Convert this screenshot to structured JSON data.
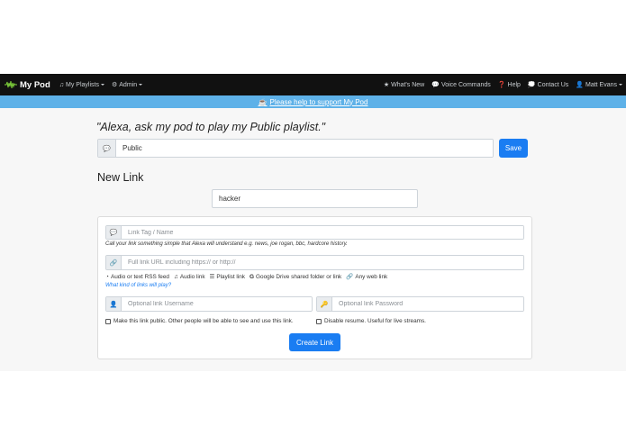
{
  "navbar": {
    "brand": "My Pod",
    "playlists": "My Playlists",
    "admin": "Admin",
    "whats_new": "What's New",
    "voice_commands": "Voice Commands",
    "help": "Help",
    "contact": "Contact Us",
    "user": "Matt Evans"
  },
  "banner": {
    "text": "Please help to support My Pod"
  },
  "quote": "\"Alexa, ask my pod to play my Public playlist.\"",
  "playlist": {
    "name_value": "Public",
    "save_label": "Save"
  },
  "new_link": {
    "heading": "New Link",
    "search_value": "hacker",
    "tag_placeholder": "Link Tag / Name",
    "tag_help": "Call your link something simple that Alexa will understand e.g. news, joe rogan, bbc, hardcore history.",
    "url_placeholder": "Full link URL including https:// or http://",
    "types": {
      "audio_feed": "Audio or text RSS feed",
      "audio_link": "Audio link",
      "playlist_link": "Playlist link",
      "gdrive": "Google Drive shared folder or link",
      "web": "Any web link"
    },
    "types_link": "What kind of links will play?",
    "username_placeholder": "Optional link Username",
    "password_placeholder": "Optional link Password",
    "public_label": "Make this link public. Other people will be able to see and use this link.",
    "resume_label": "Disable resume. Useful for live streams.",
    "create_label": "Create Link"
  },
  "colors": {
    "navbar": "#111111",
    "banner": "#5eb1e8",
    "primary": "#1a7df2"
  }
}
